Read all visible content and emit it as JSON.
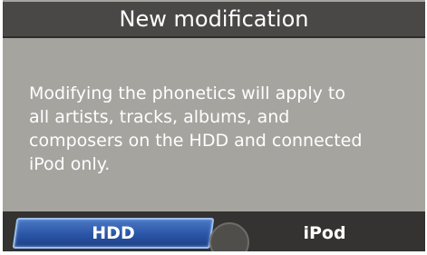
{
  "dialog": {
    "title": "New modification",
    "message": "Modifying the phonetics will apply to\nall artists, tracks, albums, and\ncomposers on the HDD and connected\niPod only."
  },
  "buttons": {
    "hdd_label": "HDD",
    "ipod_label": "iPod"
  },
  "colors": {
    "screen_background": "#a6a49f",
    "title_bar": "#4a4846",
    "bottom_bar": "#343331",
    "selected_button": "#2a55a6",
    "text": "#ffffff"
  }
}
